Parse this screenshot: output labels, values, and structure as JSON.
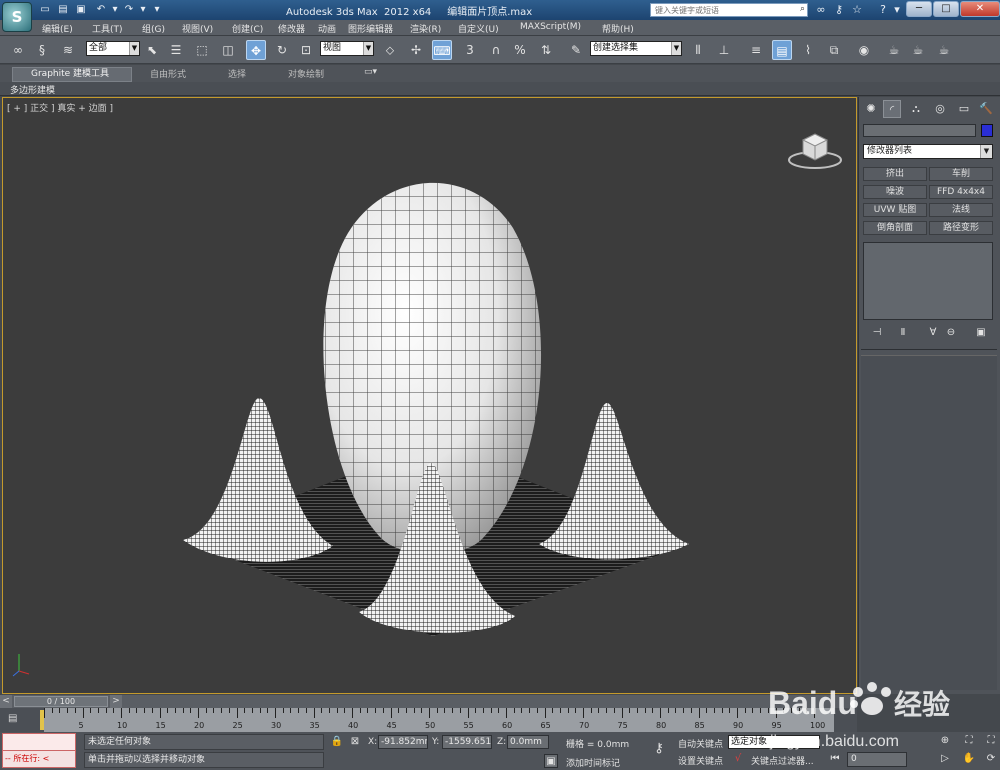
{
  "window": {
    "title": "Autodesk 3ds Max  2012 x64     编辑面片顶点.max",
    "search_placeholder": "键入关键字或短语",
    "minimize": "─",
    "maximize": "□",
    "close": "✕"
  },
  "menu": [
    "编辑(E)",
    "工具(T)",
    "组(G)",
    "视图(V)",
    "创建(C)",
    "修改器",
    "动画",
    "图形编辑器",
    "渲染(R)",
    "自定义(U)",
    "MAXScript(M)",
    "帮助(H)"
  ],
  "toolbar": {
    "selection_filter": "全部",
    "reference_coord": "视图",
    "named_selection": "创建选择集",
    "snap_3": "3",
    "percent_snap": "%"
  },
  "ribbon": {
    "tabs": [
      "Graphite 建模工具",
      "自由形式",
      "选择",
      "对象绘制"
    ],
    "subtab": "多边形建模"
  },
  "viewport": {
    "label": "[ + ] 正交 ] 真实 + 边面 ]"
  },
  "command_panel": {
    "modifier_list": "修改器列表",
    "modifiers": [
      [
        "挤出",
        "车削"
      ],
      [
        "噪波",
        "FFD 4x4x4"
      ],
      [
        "UVW 贴图",
        "法线"
      ],
      [
        "倒角剖面",
        "路径变形"
      ]
    ],
    "color": "#2a2ed4"
  },
  "timeline": {
    "slider": "0 / 100",
    "ticks": [
      0,
      5,
      10,
      15,
      20,
      25,
      30,
      35,
      40,
      45,
      50,
      55,
      60,
      65,
      70,
      75,
      80,
      85,
      90,
      95,
      100
    ]
  },
  "status": {
    "maxscript_label": "所在行:",
    "prompt1": "未选定任何对象",
    "prompt2": "单击并拖动以选择并移动对象",
    "x_label": "X:",
    "x_value": "-91.852mm",
    "y_label": "Y:",
    "y_value": "-1559.651r",
    "z_label": "Z:",
    "z_value": "0.0mm",
    "grid": "栅格 = 0.0mm",
    "add_time_tag": "添加时间标记",
    "auto_key": "自动关键点",
    "set_key": "设置关键点",
    "selection_dropdown": "选定对象",
    "key_filters": "关键点过滤器...",
    "frame": "0"
  },
  "watermark": {
    "brand": "Baidu",
    "suffix": "经验",
    "url": "jingyan.baidu.com"
  }
}
